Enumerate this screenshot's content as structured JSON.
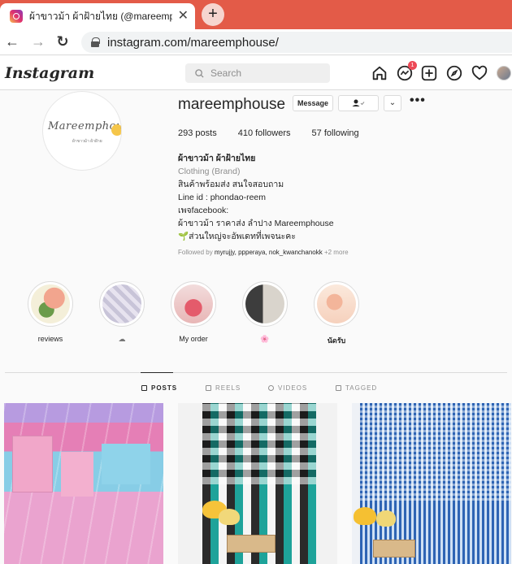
{
  "browser": {
    "tab_title": "ผ้าขาวม้า ผ้าฝ้ายไทย (@mareemphouse)",
    "close_glyph": "✕",
    "newtab_glyph": "+",
    "back_glyph": "←",
    "forward_glyph": "→",
    "reload_glyph": "↻",
    "url": "instagram.com/mareemphouse/"
  },
  "header": {
    "logo": "Instagram",
    "search_placeholder": "Search",
    "messenger_badge": "1",
    "icons": [
      "home-icon",
      "messenger-icon",
      "new-post-icon",
      "explore-icon",
      "activity-heart-icon",
      "profile-avatar"
    ]
  },
  "profile": {
    "avatar_text": "Mareemphouse",
    "avatar_subtext": "ผ้าขาวม้า ผ้าฝ้าย",
    "username": "mareemphouse",
    "message_label": "Message",
    "more_glyph": "•••",
    "caret_glyph": "⌄",
    "stats": {
      "posts": "293 posts",
      "followers": "410 followers",
      "following": "57 following"
    },
    "bio": {
      "name": "ผ้าขาวม้า ผ้าฝ้ายไทย",
      "category": "Clothing (Brand)",
      "lines": [
        "สินค้าพร้อมส่ง สนใจสอบถาม",
        "Line id : phondao-reem",
        "เพจfacebook:",
        "ผ้าขาวม้า ราคาส่ง ลำปาง Mareemphouse",
        "🌱ส่วนใหญ่จะอัพเดทที่เพจนะคะ"
      ]
    },
    "followed_by": {
      "prefix": "Followed by ",
      "names": "myrujjy, ppperaya, nok_kwanchanokk",
      "suffix": " +2 more"
    }
  },
  "highlights": [
    {
      "label": "reviews"
    },
    {
      "label": "☁"
    },
    {
      "label": "My order"
    },
    {
      "label": "🌸"
    },
    {
      "label": "นัดรับ"
    }
  ],
  "tabs": {
    "posts": "POSTS",
    "reels": "REELS",
    "videos": "VIDEOS",
    "tagged": "TAGGED"
  },
  "colors": {
    "tabbar": "#e35b48",
    "background": "#fafafa",
    "border": "#dbdbdb",
    "badge": "#ed4956"
  }
}
